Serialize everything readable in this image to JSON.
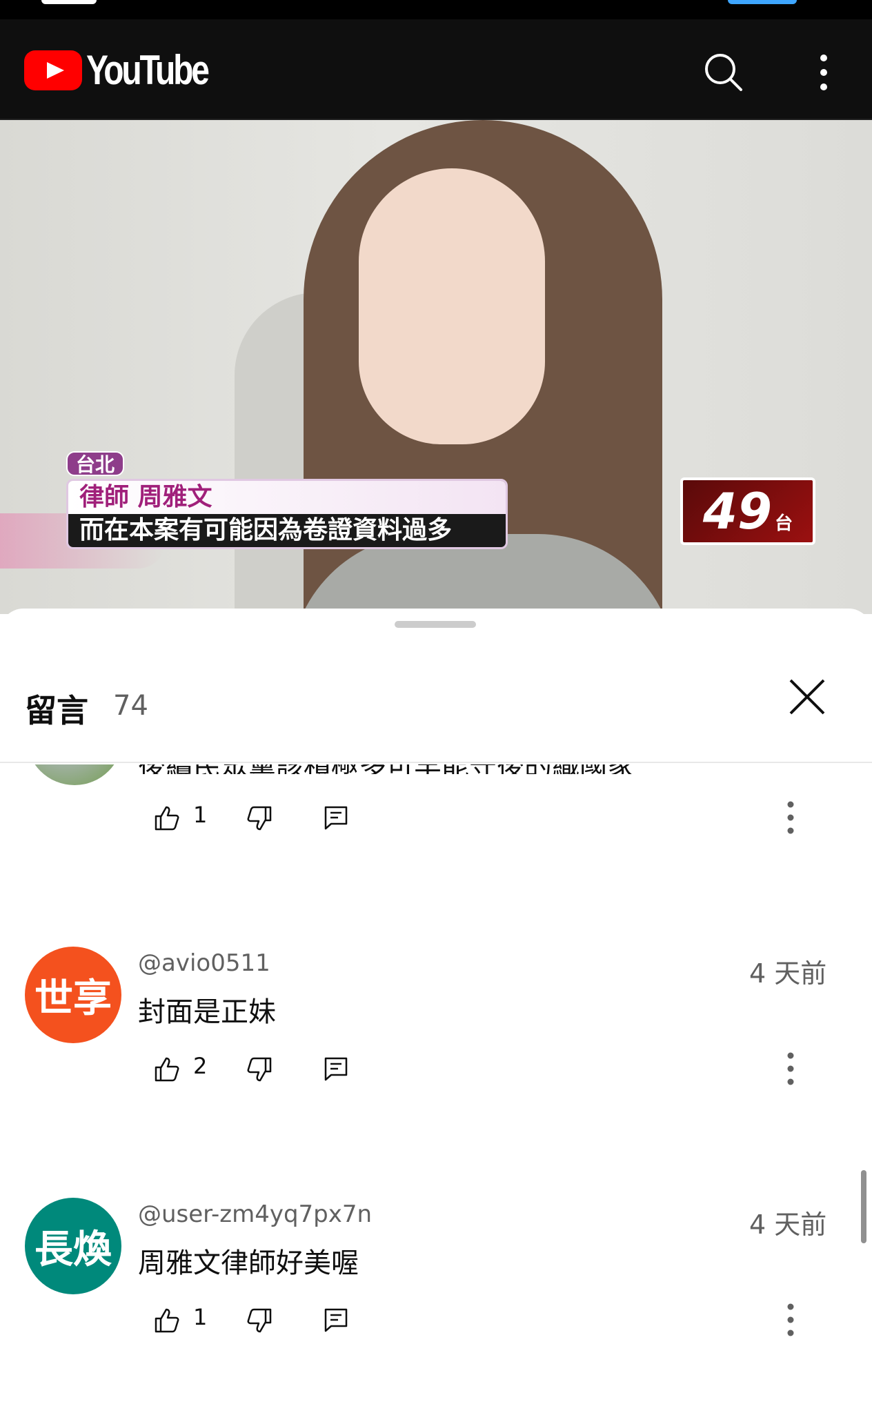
{
  "app": {
    "name": "YouTube"
  },
  "video": {
    "location_badge": "台北",
    "caption_name": "律師 周雅文",
    "caption_text": "而在本案有可能因為卷證資料過多",
    "channel_number": "49",
    "channel_suffix": "台"
  },
  "comments_panel": {
    "title": "留言",
    "count": "74",
    "partial_comment": {
      "text": "後續民眾黨該積極多可羊能守後的織國家",
      "likes": "1"
    },
    "comments": [
      {
        "avatar_text": "世享",
        "avatar_color": "#f4511e",
        "author": "@avio0511",
        "time": "4 天前",
        "text": "封面是正妹",
        "likes": "2"
      },
      {
        "avatar_text": "長煥",
        "avatar_color": "#00897b",
        "author": "@user-zm4yq7px7n",
        "time": "4 天前",
        "text": "周雅文律師好美喔",
        "likes": "1"
      }
    ]
  },
  "icons": [
    "youtube-logo-icon",
    "search-icon",
    "more-vert-icon",
    "close-icon",
    "like-icon",
    "dislike-icon",
    "reply-icon",
    "kebab-icon"
  ],
  "colors": {
    "topbar": "#0f0f0f",
    "brand_red": "#ff0000",
    "text_secondary": "#606060"
  }
}
